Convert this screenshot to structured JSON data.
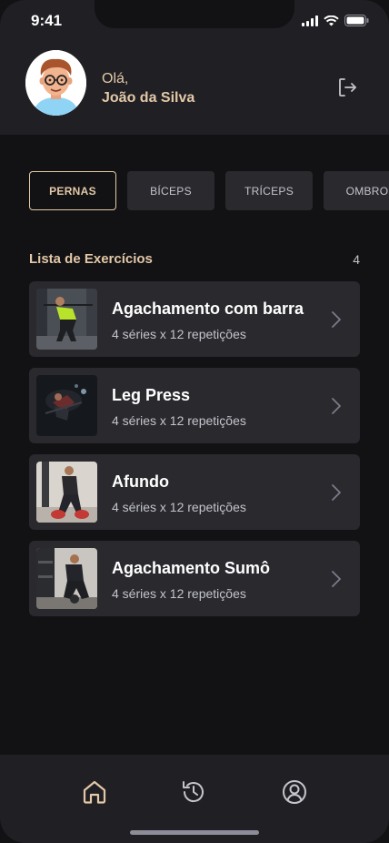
{
  "status": {
    "time": "9:41"
  },
  "user": {
    "greeting": "Olá,",
    "name": "João da Silva"
  },
  "groups": [
    {
      "label": "PERNAS",
      "active": true
    },
    {
      "label": "BÍCEPS",
      "active": false
    },
    {
      "label": "TRÍCEPS",
      "active": false
    },
    {
      "label": "OMBRO",
      "active": false
    }
  ],
  "list": {
    "title": "Lista de Exercícios",
    "count": "4",
    "items": [
      {
        "name": "Agachamento com barra",
        "info": "4 séries x 12 repetições"
      },
      {
        "name": "Leg Press",
        "info": "4 séries x 12 repetições"
      },
      {
        "name": "Afundo",
        "info": "4 séries x 12 repetições"
      },
      {
        "name": "Agachamento Sumô",
        "info": "4 séries x 12 repetições"
      }
    ]
  },
  "nav": {
    "items": [
      {
        "icon": "home-icon",
        "active": true
      },
      {
        "icon": "history-icon",
        "active": false
      },
      {
        "icon": "profile-icon",
        "active": false
      }
    ]
  },
  "colors": {
    "accent": "#E3C8A8",
    "background": "#121214",
    "card": "#29292E",
    "header": "#202024"
  }
}
